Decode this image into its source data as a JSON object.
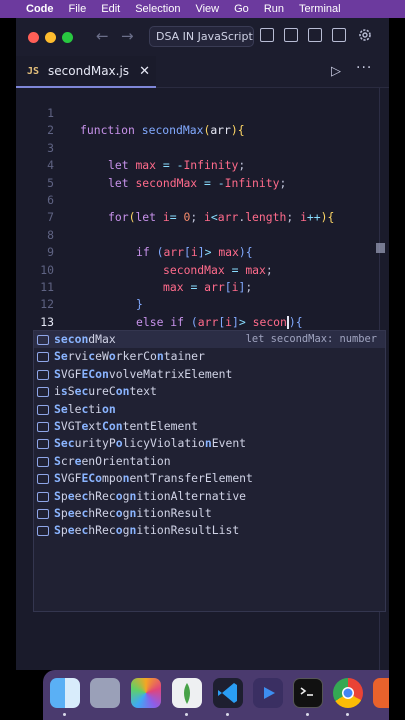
{
  "menubar": {
    "apple_glyph": "",
    "items": [
      "Code",
      "File",
      "Edit",
      "Selection",
      "View",
      "Go",
      "Run",
      "Terminal"
    ]
  },
  "titlebar": {
    "back_glyph": "←",
    "forward_glyph": "→",
    "search_text": "DSA IN JavaScript"
  },
  "tab": {
    "badge": "JS",
    "filename": "secondMax.js",
    "close_glyph": "✕"
  },
  "toolbar": {
    "run_glyph": "▷",
    "more_glyph": "···"
  },
  "editor": {
    "line_numbers": [
      "1",
      "2",
      "3",
      "4",
      "5",
      "6",
      "7",
      "8",
      "9",
      "10",
      "11",
      "12",
      "13"
    ],
    "current_line": "13"
  },
  "suggest": {
    "selected_detail": "let secondMax: number",
    "items": [
      "secondMax",
      "ServiceWorkerContainer",
      "SVGFEConvolveMatrixElement",
      "isSecureContext",
      "Selection",
      "SVGTextContentElement",
      "SecurityPolicyViolationEvent",
      "ScreenOrientation",
      "SVGFEComponentTransferElement",
      "SpeechRecognitionAlternative",
      "SpeechRecognitionResult",
      "SpeechRecognitionResultList"
    ]
  },
  "colors": {
    "menubar": "#6c3a9e",
    "editor_bg": "#1a1b2b",
    "keyword": "#c792ea",
    "function": "#82aaff",
    "variable": "#ff6b8b",
    "dock": "#4a3a6e"
  },
  "dock_apps": [
    "finder-icon",
    "launchpad-icon",
    "photos-icon",
    "mongodb-icon",
    "vscode-icon",
    "media-player-icon",
    "terminal-icon",
    "chrome-icon",
    "app-icon"
  ]
}
